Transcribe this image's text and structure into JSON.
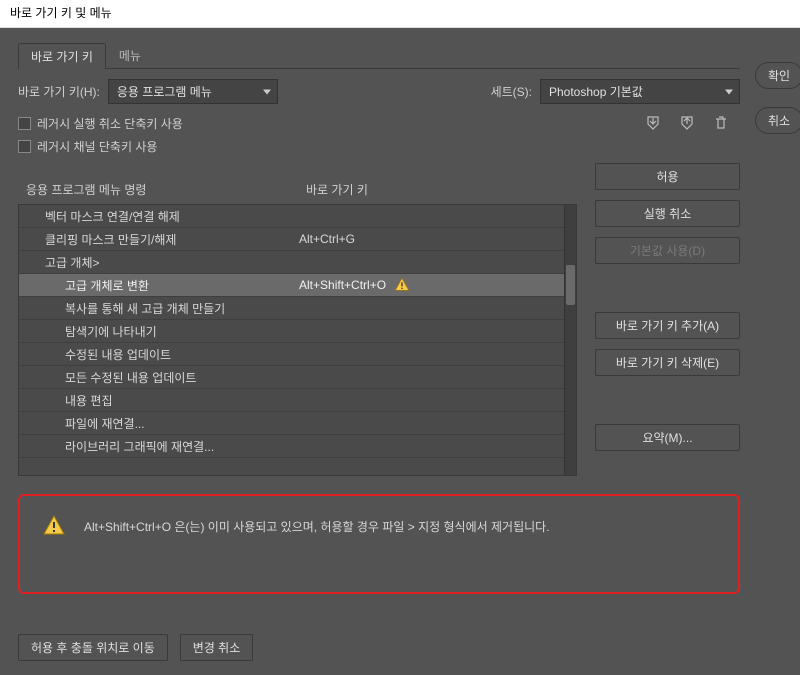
{
  "window": {
    "title": "바로 가기 키 및 메뉴"
  },
  "tabs": {
    "shortcuts": "바로 가기 키",
    "menus": "메뉴"
  },
  "shortcutFor": {
    "label": "바로 가기 키(H):",
    "value": "응용 프로그램 메뉴"
  },
  "set": {
    "label": "세트(S):",
    "value": "Photoshop 기본값"
  },
  "legacyUndo": "레거시 실행 취소 단축키 사용",
  "legacyChannel": "레거시 채널 단축키 사용",
  "columns": {
    "command": "응용 프로그램 메뉴 명령",
    "shortcut": "바로 가기 키"
  },
  "tree": [
    {
      "label": "벡터 마스크 연결/연결 해제",
      "shortcut": "",
      "indent": 1
    },
    {
      "label": "클리핑 마스크 만들기/해제",
      "shortcut": "Alt+Ctrl+G",
      "indent": 1
    },
    {
      "label": "고급 개체>",
      "shortcut": "",
      "indent": 1
    },
    {
      "label": "고급 개체로 변환",
      "shortcut": "Alt+Shift+Ctrl+O",
      "indent": 2,
      "selected": true,
      "warn": true
    },
    {
      "label": "복사를 통해 새 고급 개체 만들기",
      "shortcut": "",
      "indent": 2
    },
    {
      "label": "탐색기에 나타내기",
      "shortcut": "",
      "indent": 2
    },
    {
      "label": "수정된 내용 업데이트",
      "shortcut": "",
      "indent": 2
    },
    {
      "label": "모든 수정된 내용 업데이트",
      "shortcut": "",
      "indent": 2
    },
    {
      "label": "내용 편집",
      "shortcut": "",
      "indent": 2
    },
    {
      "label": "파일에 재연결...",
      "shortcut": "",
      "indent": 2
    },
    {
      "label": "라이브러리 그래픽에 재연결...",
      "shortcut": "",
      "indent": 2
    }
  ],
  "sideButtons": {
    "accept": "허용",
    "undo": "실행 취소",
    "useDefault": "기본값 사용(D)",
    "addShortcut": "바로 가기 키 추가(A)",
    "deleteShortcut": "바로 가기 키 삭제(E)",
    "summarize": "요약(M)..."
  },
  "warning": {
    "text": "Alt+Shift+Ctrl+O 은(는) 이미 사용되고 있으며, 허용할 경우 파일 > 지정 형식에서 제거됩니다."
  },
  "bottomButtons": {
    "goToConflict": "허용 후 충돌 위치로 이동",
    "undoChanges": "변경 취소"
  },
  "dialogButtons": {
    "ok": "확인",
    "cancel": "취소"
  }
}
